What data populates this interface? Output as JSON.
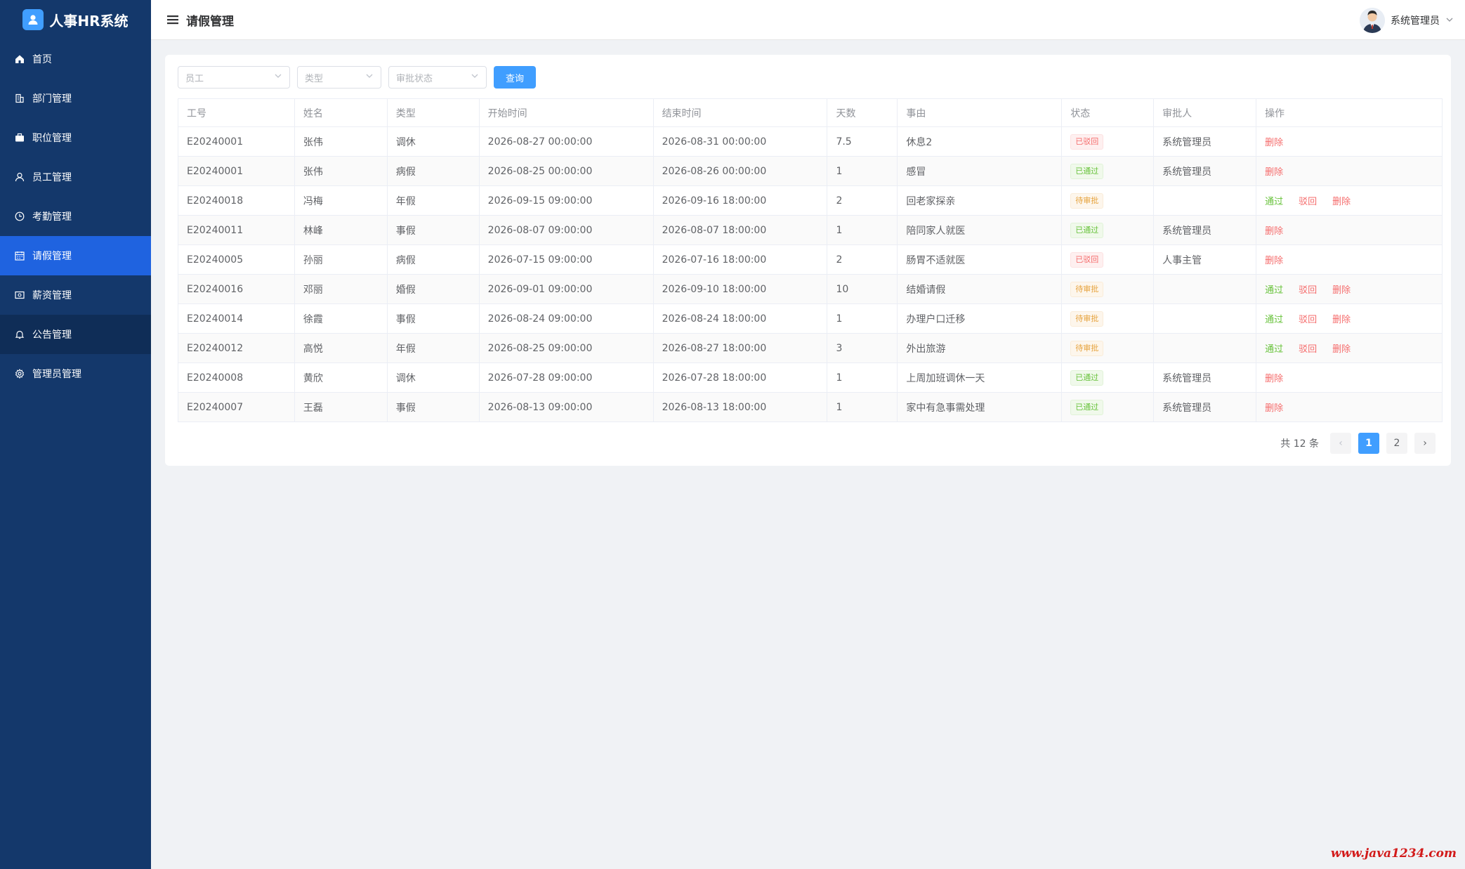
{
  "app": {
    "title": "人事HR系统"
  },
  "sidebar": {
    "items": [
      {
        "label": "首页",
        "icon": "home-icon"
      },
      {
        "label": "部门管理",
        "icon": "building-icon"
      },
      {
        "label": "职位管理",
        "icon": "briefcase-icon"
      },
      {
        "label": "员工管理",
        "icon": "user-icon"
      },
      {
        "label": "考勤管理",
        "icon": "clock-icon"
      },
      {
        "label": "请假管理",
        "icon": "calendar-icon"
      },
      {
        "label": "薪资管理",
        "icon": "money-icon"
      },
      {
        "label": "公告管理",
        "icon": "bell-icon"
      },
      {
        "label": "管理员管理",
        "icon": "gear-icon"
      }
    ],
    "active_index": 5,
    "hover_index": 7,
    "colors": {
      "bg": "#14386b",
      "active": "#1f63e0",
      "hover": "#0f2d57"
    }
  },
  "header": {
    "page_title": "请假管理",
    "user_name": "系统管理员"
  },
  "filters": {
    "employee_placeholder": "员工",
    "type_placeholder": "类型",
    "status_placeholder": "审批状态",
    "query_label": "查询"
  },
  "table": {
    "columns": [
      "工号",
      "姓名",
      "类型",
      "开始时间",
      "结束时间",
      "天数",
      "事由",
      "状态",
      "审批人",
      "操作"
    ],
    "rows": [
      {
        "id": "E20240001",
        "name": "张伟",
        "type": "调休",
        "start": "2026-08-27 00:00:00",
        "end": "2026-08-31 00:00:00",
        "days": "7.5",
        "reason": "休息2",
        "status": "已驳回",
        "status_kind": "rejected",
        "approver": "系统管理员",
        "ops": [
          "删除"
        ]
      },
      {
        "id": "E20240001",
        "name": "张伟",
        "type": "病假",
        "start": "2026-08-25 00:00:00",
        "end": "2026-08-26 00:00:00",
        "days": "1",
        "reason": "感冒",
        "status": "已通过",
        "status_kind": "approved",
        "approver": "系统管理员",
        "ops": [
          "删除"
        ]
      },
      {
        "id": "E20240018",
        "name": "冯梅",
        "type": "年假",
        "start": "2026-09-15 09:00:00",
        "end": "2026-09-16 18:00:00",
        "days": "2",
        "reason": "回老家探亲",
        "status": "待审批",
        "status_kind": "pending",
        "approver": "",
        "ops": [
          "通过",
          "驳回",
          "删除"
        ]
      },
      {
        "id": "E20240011",
        "name": "林峰",
        "type": "事假",
        "start": "2026-08-07 09:00:00",
        "end": "2026-08-07 18:00:00",
        "days": "1",
        "reason": "陪同家人就医",
        "status": "已通过",
        "status_kind": "approved",
        "approver": "系统管理员",
        "ops": [
          "删除"
        ]
      },
      {
        "id": "E20240005",
        "name": "孙丽",
        "type": "病假",
        "start": "2026-07-15 09:00:00",
        "end": "2026-07-16 18:00:00",
        "days": "2",
        "reason": "肠胃不适就医",
        "status": "已驳回",
        "status_kind": "rejected",
        "approver": "人事主管",
        "ops": [
          "删除"
        ]
      },
      {
        "id": "E20240016",
        "name": "邓丽",
        "type": "婚假",
        "start": "2026-09-01 09:00:00",
        "end": "2026-09-10 18:00:00",
        "days": "10",
        "reason": "结婚请假",
        "status": "待审批",
        "status_kind": "pending",
        "approver": "",
        "ops": [
          "通过",
          "驳回",
          "删除"
        ]
      },
      {
        "id": "E20240014",
        "name": "徐霞",
        "type": "事假",
        "start": "2026-08-24 09:00:00",
        "end": "2026-08-24 18:00:00",
        "days": "1",
        "reason": "办理户口迁移",
        "status": "待审批",
        "status_kind": "pending",
        "approver": "",
        "ops": [
          "通过",
          "驳回",
          "删除"
        ]
      },
      {
        "id": "E20240012",
        "name": "高悦",
        "type": "年假",
        "start": "2026-08-25 09:00:00",
        "end": "2026-08-27 18:00:00",
        "days": "3",
        "reason": "外出旅游",
        "status": "待审批",
        "status_kind": "pending",
        "approver": "",
        "ops": [
          "通过",
          "驳回",
          "删除"
        ]
      },
      {
        "id": "E20240008",
        "name": "黄欣",
        "type": "调休",
        "start": "2026-07-28 09:00:00",
        "end": "2026-07-28 18:00:00",
        "days": "1",
        "reason": "上周加班调休一天",
        "status": "已通过",
        "status_kind": "approved",
        "approver": "系统管理员",
        "ops": [
          "删除"
        ]
      },
      {
        "id": "E20240007",
        "name": "王磊",
        "type": "事假",
        "start": "2026-08-13 09:00:00",
        "end": "2026-08-13 18:00:00",
        "days": "1",
        "reason": "家中有急事需处理",
        "status": "已通过",
        "status_kind": "approved",
        "approver": "系统管理员",
        "ops": [
          "删除"
        ]
      }
    ]
  },
  "pagination": {
    "total_text": "共 12 条",
    "pages": [
      "1",
      "2"
    ],
    "current": "1",
    "prev": "‹",
    "next": "›"
  },
  "watermark": "www.java1234.com"
}
